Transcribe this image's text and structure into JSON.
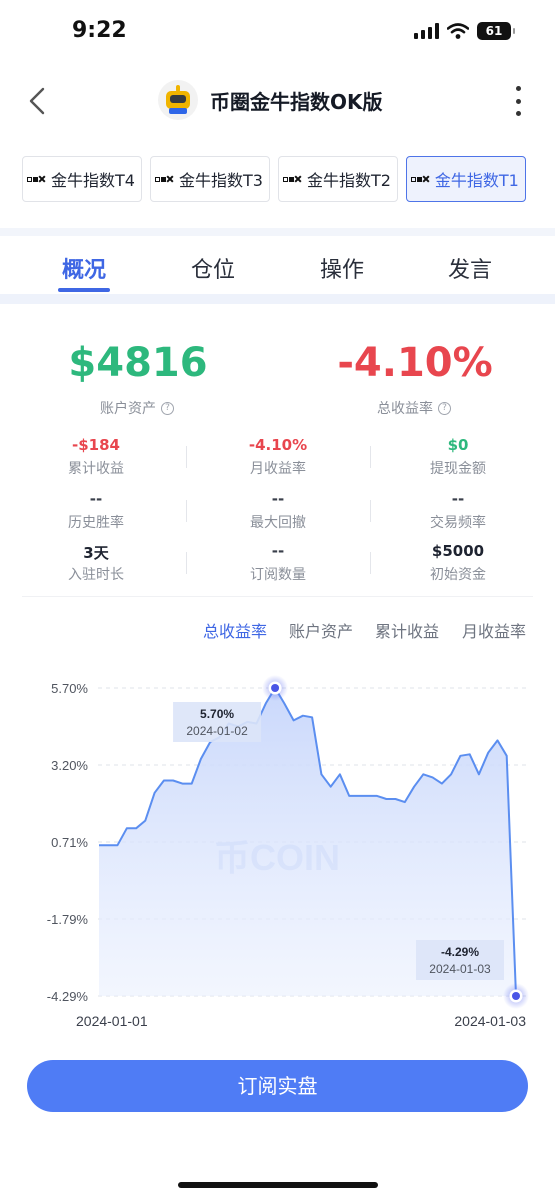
{
  "status_bar": {
    "time": "9:22",
    "battery": "61"
  },
  "nav": {
    "title": "币圈金牛指数OK版",
    "back_icon": "chevron-left-icon",
    "more_icon": "more-vertical-icon",
    "avatar_icon": "robot-icon"
  },
  "pills": [
    {
      "label": "金牛指数T4",
      "active": false
    },
    {
      "label": "金牛指数T3",
      "active": false
    },
    {
      "label": "金牛指数T2",
      "active": false
    },
    {
      "label": "金牛指数T1",
      "active": true
    }
  ],
  "tabs": [
    "概况",
    "仓位",
    "操作",
    "发言"
  ],
  "overview": {
    "assets_value": "$4816",
    "assets_label": "账户资产",
    "return_value": "-4.10%",
    "return_label": "总收益率",
    "stats": [
      {
        "value": "-$184",
        "label": "累计收益",
        "color": "#e8464e"
      },
      {
        "value": "-4.10%",
        "label": "月收益率",
        "color": "#e8464e"
      },
      {
        "value": "$0",
        "label": "提现金额",
        "color": "#2db87d"
      },
      {
        "value": "--",
        "label": "历史胜率",
        "color": "#3a3f4b"
      },
      {
        "value": "--",
        "label": "最大回撤",
        "color": "#3a3f4b"
      },
      {
        "value": "--",
        "label": "交易频率",
        "color": "#3a3f4b"
      },
      {
        "value": "3天",
        "label": "入驻时长",
        "color": "#1e2330"
      },
      {
        "value": "--",
        "label": "订阅数量",
        "color": "#3a3f4b"
      },
      {
        "value": "$5000",
        "label": "初始资金",
        "color": "#1e2330"
      }
    ]
  },
  "chart_tabs": [
    {
      "label": "总收益率",
      "active": true
    },
    {
      "label": "账户资产",
      "active": false
    },
    {
      "label": "累计收益",
      "active": false
    },
    {
      "label": "月收益率",
      "active": false
    }
  ],
  "chart_data": {
    "type": "area",
    "y_ticks": [
      "5.70%",
      "3.20%",
      "0.71%",
      "-1.79%",
      "-4.29%"
    ],
    "ylim": [
      -4.29,
      5.7
    ],
    "x_labels": [
      "2024-01-01",
      "2024-01-03"
    ],
    "watermark": "币COIN",
    "series": [
      {
        "values": [
          0.6,
          0.6,
          0.6,
          1.15,
          1.15,
          1.4,
          2.3,
          2.7,
          2.7,
          2.6,
          2.6,
          3.4,
          3.95,
          4.1,
          4.55,
          4.45,
          4.6,
          4.55,
          5.2,
          5.7,
          5.2,
          4.65,
          4.8,
          4.75,
          2.9,
          2.5,
          2.9,
          2.2,
          2.2,
          2.2,
          2.2,
          2.1,
          2.1,
          2.0,
          2.5,
          2.9,
          2.8,
          2.6,
          2.9,
          3.5,
          3.55,
          2.9,
          3.6,
          4.0,
          3.5,
          -4.29
        ]
      }
    ],
    "annotations": [
      {
        "value": "5.70%",
        "date": "2024-01-02",
        "point_index": 19
      },
      {
        "value": "-4.29%",
        "date": "2024-01-03",
        "point_index": 45
      }
    ]
  },
  "cta_label": "订阅实盘"
}
